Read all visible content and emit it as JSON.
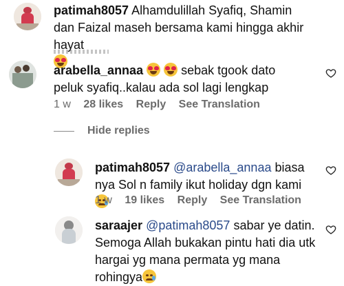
{
  "colors": {
    "like_heart": "#262626",
    "meta_text": "#6b6b6b",
    "mention": "#2a4a8a"
  },
  "comments": [
    {
      "username": "patimah8057",
      "text": "Alhamdulillah Syafiq, Shamin dan Faizal maseh bersama kami hingga akhir hayat",
      "emoji": "heart-eyes-emoji"
    },
    {
      "username": "arabella_annaa",
      "text": "sebak tgook dato peluk syafiq..kalau ada sol lagi lengkap",
      "time": "1 w",
      "likes": "28 likes",
      "reply": "Reply",
      "translate": "See Translation"
    }
  ],
  "hide_replies": "Hide replies",
  "replies": [
    {
      "username": "patimah8057",
      "mention": "@arabella_annaa",
      "text": "biasa nya Sol n family ikut holiday dgn kami",
      "time": "1 w",
      "likes": "19 likes",
      "reply": "Reply",
      "translate": "See Translation"
    },
    {
      "username": "saraajer",
      "mention": "@patimah8057",
      "text": "sabar ye datin. Semoga Allah bukakan pintu hati dia utk hargai yg mana permata yg mana rohingya"
    }
  ]
}
